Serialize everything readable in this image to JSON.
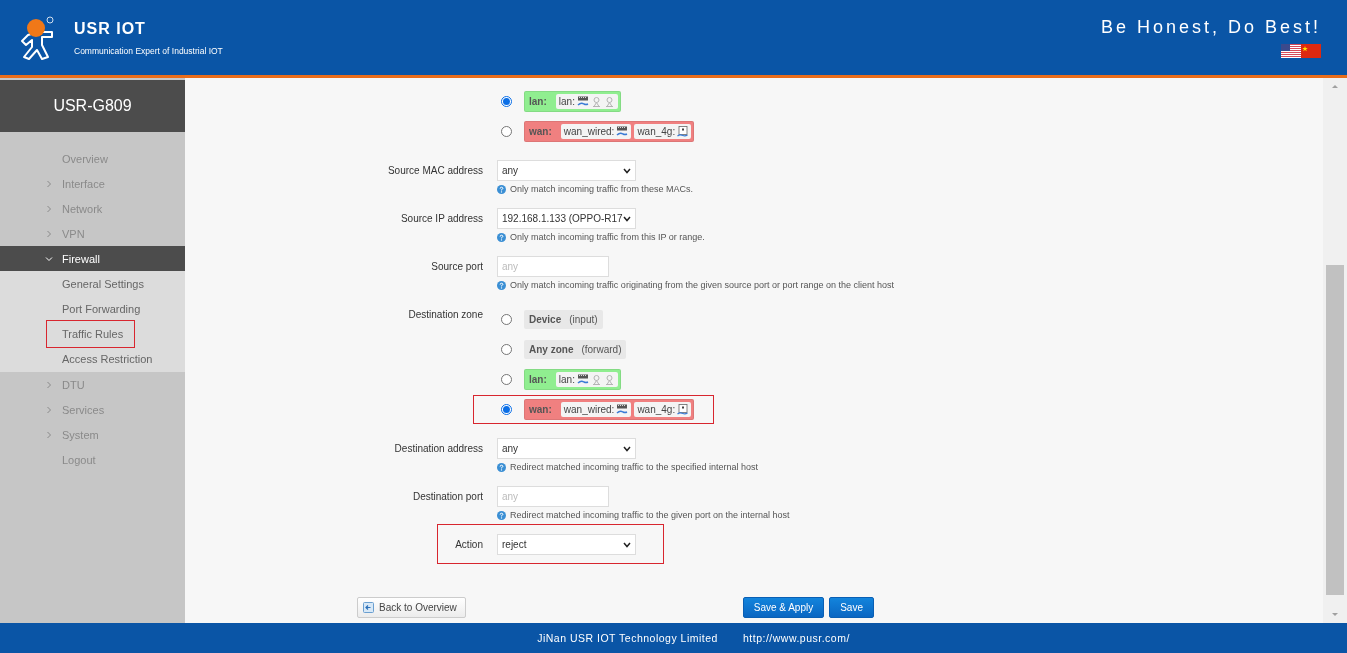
{
  "header": {
    "brand": "USR IOT",
    "tagline": "Communication Expert of Industrial IOT",
    "slogan": "Be Honest, Do Best!"
  },
  "sidebar": {
    "title": "USR-G809",
    "items": [
      {
        "kind": "link",
        "label": "Overview"
      },
      {
        "kind": "group",
        "label": "Interface",
        "expanded": false
      },
      {
        "kind": "group",
        "label": "Network",
        "expanded": false
      },
      {
        "kind": "group",
        "label": "VPN",
        "expanded": false
      },
      {
        "kind": "group",
        "label": "Firewall",
        "expanded": true,
        "children": [
          {
            "label": "General Settings",
            "highlighted": false
          },
          {
            "label": "Port Forwarding",
            "highlighted": false
          },
          {
            "label": "Traffic Rules",
            "highlighted": true
          },
          {
            "label": "Access Restriction",
            "highlighted": false
          }
        ]
      },
      {
        "kind": "group",
        "label": "DTU",
        "expanded": false
      },
      {
        "kind": "group",
        "label": "Services",
        "expanded": false
      },
      {
        "kind": "group",
        "label": "System",
        "expanded": false
      },
      {
        "kind": "link",
        "label": "Logout"
      }
    ]
  },
  "form": {
    "rows": [
      {
        "kind": "zones",
        "options": [
          {
            "kind": "zone",
            "name": "lan:",
            "color": "#90ee90",
            "selected": true,
            "highlighted": false,
            "networks": [
              {
                "label": "lan:",
                "kind": "bridge"
              }
            ]
          },
          {
            "kind": "zone",
            "name": "wan:",
            "color": "#f08080",
            "selected": false,
            "highlighted": false,
            "networks": [
              {
                "label": "wan_wired:",
                "kind": "wired"
              },
              {
                "label": "wan_4g:",
                "kind": "modem"
              }
            ]
          }
        ]
      },
      {
        "kind": "select",
        "label": "Source MAC address",
        "value": "any",
        "hint": "Only match incoming traffic from these MACs.",
        "highlighted": false
      },
      {
        "kind": "select",
        "label": "Source IP address",
        "value": "192.168.1.133 (OPPO-R17",
        "hint": "Only match incoming traffic from this IP or range.",
        "highlighted": false
      },
      {
        "kind": "input",
        "label": "Source port",
        "placeholder": "any",
        "hint": "Only match incoming traffic originating from the given source port or port range on the client host",
        "highlighted": false
      },
      {
        "kind": "zones",
        "label": "Destination zone",
        "options": [
          {
            "kind": "plain",
            "name": "Device",
            "note": "(input)",
            "selected": false,
            "highlighted": false
          },
          {
            "kind": "plain",
            "name": "Any zone",
            "note": "(forward)",
            "selected": false,
            "highlighted": false
          },
          {
            "kind": "zone",
            "name": "lan:",
            "color": "#90ee90",
            "selected": false,
            "highlighted": false,
            "networks": [
              {
                "label": "lan:",
                "kind": "bridge"
              }
            ]
          },
          {
            "kind": "zone",
            "name": "wan:",
            "color": "#f08080",
            "selected": true,
            "highlighted": true,
            "networks": [
              {
                "label": "wan_wired:",
                "kind": "wired"
              },
              {
                "label": "wan_4g:",
                "kind": "modem"
              }
            ]
          }
        ]
      },
      {
        "kind": "select",
        "label": "Destination address",
        "value": "any",
        "hint": "Redirect matched incoming traffic to the specified internal host",
        "highlighted": false
      },
      {
        "kind": "input",
        "label": "Destination port",
        "placeholder": "any",
        "hint": "Redirect matched incoming traffic to the given port on the internal host",
        "highlighted": false
      },
      {
        "kind": "select",
        "label": "Action",
        "value": "reject",
        "highlighted": true
      }
    ]
  },
  "buttons": {
    "back": "Back to Overview",
    "save_apply": "Save & Apply",
    "save": "Save"
  },
  "footer": {
    "company": "JiNan USR IOT Technology Limited",
    "url": "http://www.pusr.com/"
  }
}
